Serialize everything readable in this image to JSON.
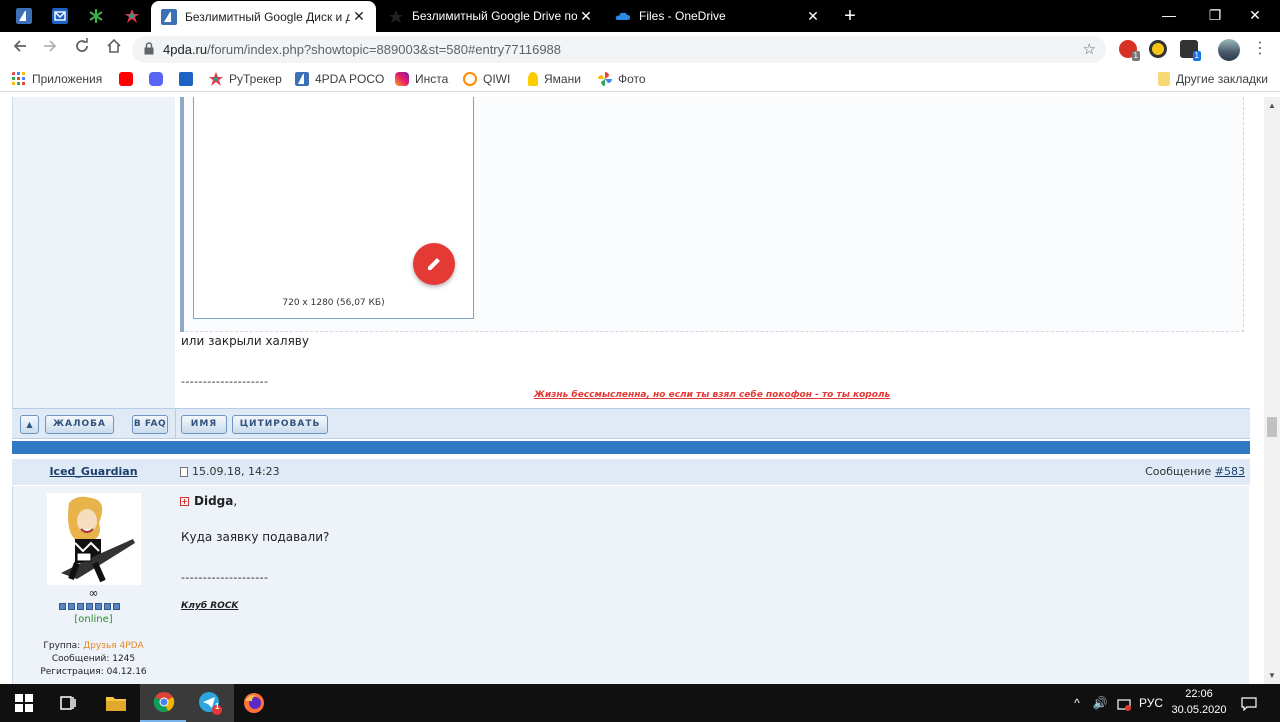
{
  "browser": {
    "tabs": [
      {
        "title": "Безлимитный Google Диск и др",
        "active": true
      },
      {
        "title": "Безлимитный Google Drive пол",
        "active": false
      },
      {
        "title": "Files - OneDrive",
        "active": false
      }
    ],
    "new_tab": "+",
    "window_controls": {
      "minimize": "—",
      "maximize": "❐",
      "close": "✕"
    },
    "url_host": "4pda.ru",
    "url_path": "/forum/index.php?showtopic=889003&st=580#entry77116988",
    "extension_badge": "1",
    "bookmarks": [
      "Приложения",
      "РуТрекер",
      "4PDA POCO",
      "Инста",
      "QIWI",
      "Ямани",
      "Фото"
    ],
    "other_bookmarks": "Другие закладки"
  },
  "post1": {
    "image_caption": "720 x 1280 (56,07 КБ)",
    "text": "или закрыли халяву",
    "separator": "--------------------",
    "signature": "Жизнь бессмысленна, но если ты взял себе покофон - то ты король"
  },
  "buttons": {
    "up": "▲",
    "complaint": "ЖАЛОБА",
    "faq": "В FAQ",
    "name": "ИМЯ",
    "quote": "ЦИТИРОВАТЬ"
  },
  "post2": {
    "author": "Iced_Guardian",
    "date": "15.09.18, 14:23",
    "message_label": "Сообщение ",
    "message_number": "#583",
    "rank_symbol": "∞",
    "rep_pips": 7,
    "status": "[online]",
    "group_label": "Группа: ",
    "group": "Друзья 4PDA",
    "messages": "Сообщений: 1245",
    "registered": "Регистрация: 04.12.16",
    "quoted_user": "Didga",
    "quoted_suffix": ",",
    "text": "Куда заявку подавали?",
    "separator": "--------------------",
    "signature": "Клуб ROCK"
  },
  "taskbar": {
    "telegram_badge": "1",
    "language": "РУС",
    "time": "22:06",
    "date": "30.05.2020"
  },
  "colors": {
    "tabstrip": "#000000",
    "forum_blue": "#2f79c2",
    "edit_fab": "#e53935",
    "signature_red": "#e53935",
    "group_orange": "#e8871e",
    "online_green": "#2e8b2e"
  }
}
